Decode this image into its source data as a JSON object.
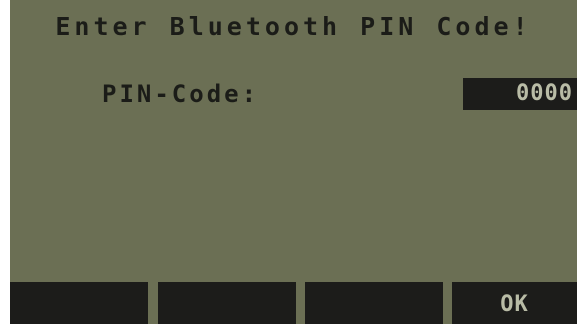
{
  "dialog": {
    "title": "Enter Bluetooth PIN Code!",
    "pin_label": "PIN-Code:",
    "pin_value": "0000"
  },
  "softkeys": [
    "",
    "",
    "",
    "OK"
  ],
  "colors": {
    "screen_background": "#6b6f54",
    "text": "#1b1c18",
    "inverse_background": "#1c1c1a",
    "inverse_text": "#b9bca6"
  }
}
